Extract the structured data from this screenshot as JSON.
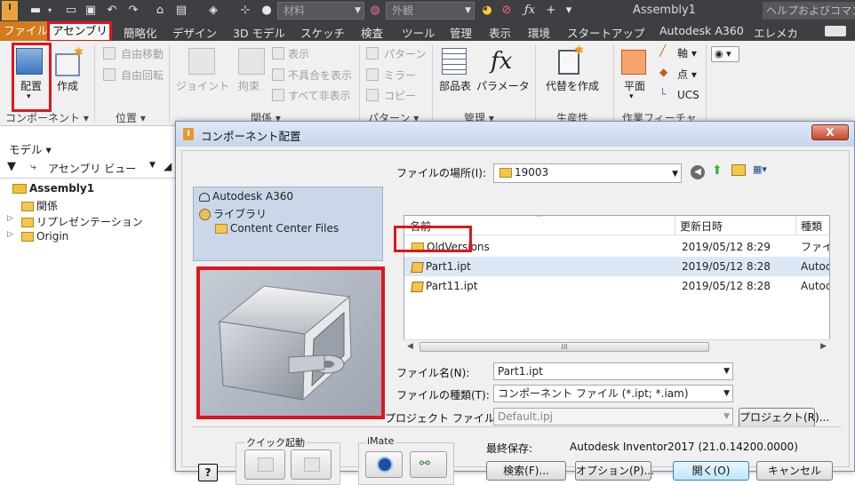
{
  "titlebar": {
    "app_title": "Assembly1",
    "material_placeholder": "材料",
    "appearance_placeholder": "外観",
    "help_search": "ヘルプおよびコマン"
  },
  "menu": {
    "items": [
      "ファイル",
      "アセンブリ",
      "簡略化",
      "デザイン",
      "3D モデル",
      "スケッチ",
      "検査",
      "ツール",
      "管理",
      "表示",
      "環境",
      "スタートアップ",
      "Autodesk A360",
      "エレメカ"
    ]
  },
  "ribbon": {
    "place_label": "配置",
    "create_label": "作成",
    "component_panel": "コンポーネント ▾",
    "position_panel": "位置 ▾",
    "relations_panel": "関係 ▾",
    "pattern_panel": "パターン ▾",
    "manage_panel": "管理 ▾",
    "productivity_panel": "生産性",
    "workfeature_panel": "作業フィーチャ",
    "free_move": "自由移動",
    "free_rotate": "自由回転",
    "joint": "ジョイント",
    "constrain": "拘束",
    "show": "表示",
    "show_sick": "不具合を表示",
    "hide_all": "すべて非表示",
    "pattern": "パターン",
    "mirror": "ミラー",
    "copy": "コピー",
    "bom": "部品表",
    "parameters": "パラメータ",
    "substitute": "代替を作成",
    "plane": "平面",
    "axis": "軸 ▾",
    "point": "点 ▾",
    "ucs": "UCS"
  },
  "browser": {
    "title": "モデル ▾",
    "view": "アセンブリ ビュー",
    "items": [
      "Assembly1",
      "関係",
      "リプレゼンテーション",
      "Origin"
    ]
  },
  "dialog": {
    "title": "コンポーネント配置",
    "close": "X",
    "locations": [
      "Autodesk A360",
      "ライブラリ",
      "Content Center Files"
    ],
    "look_in_label": "ファイルの場所(I):",
    "look_in_value": "19003",
    "columns": [
      "名前",
      "更新日時",
      "種類"
    ],
    "files": [
      {
        "name": "OldVersions",
        "date": "2019/05/12 8:29",
        "type": "ファイ",
        "kind": "folder"
      },
      {
        "name": "Part1.ipt",
        "date": "2019/05/12 8:28",
        "type": "Autoc",
        "kind": "ipt"
      },
      {
        "name": "Part11.ipt",
        "date": "2019/05/12 8:28",
        "type": "Autoc",
        "kind": "ipt"
      }
    ],
    "scroll_grip": "III",
    "filename_label": "ファイル名(N):",
    "filename_value": "Part1.ipt",
    "filetype_label": "ファイルの種類(T):",
    "filetype_value": "コンポーネント ファイル (*.ipt; *.iam)",
    "project_label": "プロジェクト ファイル(J):",
    "project_value": "Default.ipj",
    "project_button": "プロジェクト(R)...",
    "quick_launch": "クイック起動",
    "imate": "iMate",
    "last_saved_label": "最終保存:",
    "last_saved_value": "Autodesk Inventor2017 (21.0.14200.0000)",
    "help_button": "?",
    "search_button": "検索(F)...",
    "options_button": "オプション(P)...",
    "open_button": "開く(O)",
    "cancel_button": "キャンセル"
  },
  "colors": {
    "highlight": "#e0151d",
    "file_menu": "#d47b1d",
    "dark_chrome": "#3d3f43"
  }
}
